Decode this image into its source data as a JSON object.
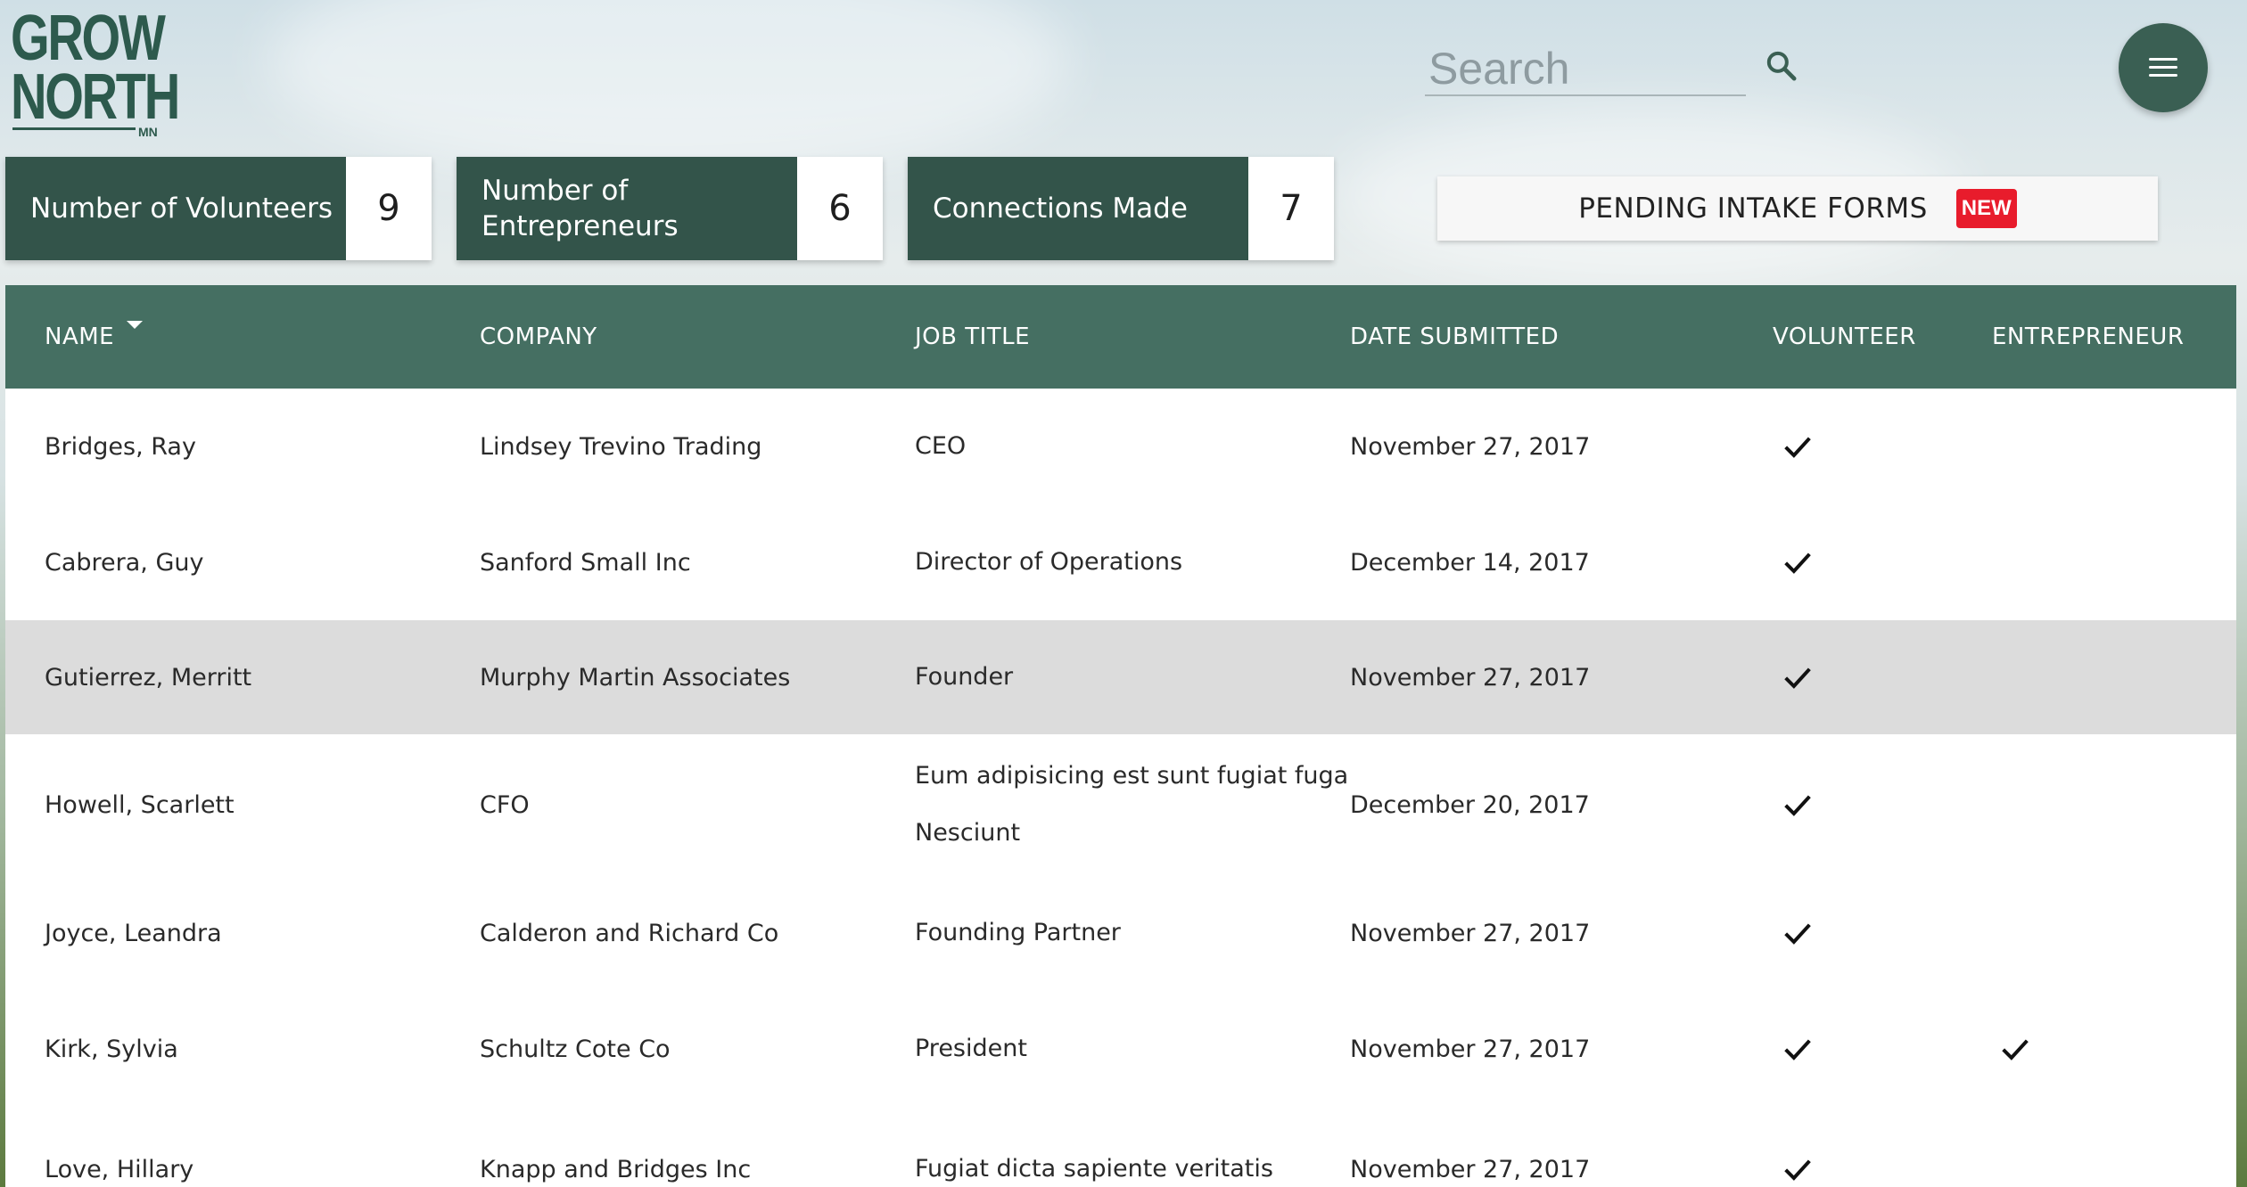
{
  "brand": {
    "line1": "GROW",
    "line2": "NORTH",
    "suffix": "MN"
  },
  "search": {
    "placeholder": "Search"
  },
  "stats": [
    {
      "label": "Number of Volunteers",
      "value": "9"
    },
    {
      "label": "Number of Entrepreneurs",
      "value": "6"
    },
    {
      "label": "Connections Made",
      "value": "7"
    }
  ],
  "pending": {
    "label": "PENDING INTAKE FORMS",
    "badge": "NEW"
  },
  "table": {
    "columns": [
      "NAME",
      "COMPANY",
      "JOB TITLE",
      "DATE SUBMITTED",
      "VOLUNTEER",
      "ENTREPRENEUR"
    ],
    "sorted_column": "NAME",
    "rows": [
      {
        "name": "Bridges, Ray",
        "company": "Lindsey Trevino Trading",
        "job_title": [
          "CEO"
        ],
        "date": "November 27, 2017",
        "volunteer": true,
        "entrepreneur": false
      },
      {
        "name": "Cabrera, Guy",
        "company": "Sanford Small Inc",
        "job_title": [
          "Director of Operations"
        ],
        "date": "December 14, 2017",
        "volunteer": true,
        "entrepreneur": false
      },
      {
        "name": "Gutierrez, Merritt",
        "company": "Murphy Martin Associates",
        "job_title": [
          "Founder"
        ],
        "date": "November 27, 2017",
        "volunteer": true,
        "entrepreneur": false,
        "highlighted": true
      },
      {
        "name": "Howell, Scarlett",
        "company": "CFO",
        "job_title": [
          "Eum adipisicing est sunt fugiat fuga",
          "Nesciunt"
        ],
        "date": "December 20, 2017",
        "volunteer": true,
        "entrepreneur": false
      },
      {
        "name": "Joyce, Leandra",
        "company": "Calderon and Richard Co",
        "job_title": [
          "Founding Partner"
        ],
        "date": "November 27, 2017",
        "volunteer": true,
        "entrepreneur": false
      },
      {
        "name": "Kirk, Sylvia",
        "company": "Schultz Cote Co",
        "job_title": [
          "President"
        ],
        "date": "November 27, 2017",
        "volunteer": true,
        "entrepreneur": true
      },
      {
        "name": "Love, Hillary",
        "company": "Knapp and Bridges Inc",
        "job_title": [
          "Fugiat dicta sapiente veritatis"
        ],
        "date": "November 27, 2017",
        "volunteer": true,
        "entrepreneur": false
      }
    ]
  },
  "colors": {
    "primary": "#33544a",
    "header": "#456f62",
    "badge": "#e81c2c"
  }
}
